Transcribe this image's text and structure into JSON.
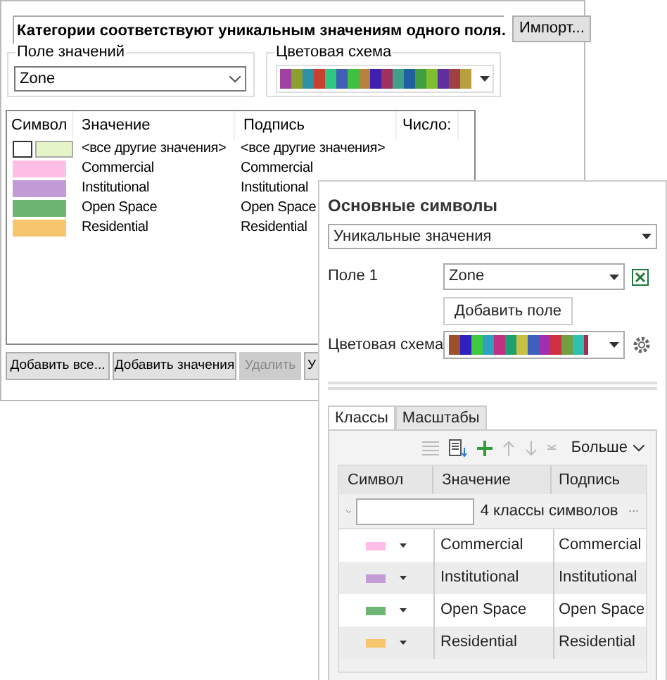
{
  "dialog": {
    "description": "Категории соответствуют уникальным значениям одного поля.",
    "import_button": "Импорт...",
    "value_field": {
      "legend": "Поле значений",
      "value": "Zone"
    },
    "color_scheme": {
      "legend": "Цветовая схема"
    },
    "table": {
      "columns": [
        "Символ",
        "Значение",
        "Подпись",
        "Число:"
      ],
      "rows": [
        {
          "kind": "other",
          "value": "<все другие значения>",
          "label": "<все другие значения>",
          "color": "#e6f5c8"
        },
        {
          "kind": "class",
          "value": "Commercial",
          "label": "Commercial",
          "color": "#ffbee6"
        },
        {
          "kind": "class",
          "value": "Institutional",
          "label": "Institutional",
          "color": "#c39bd7"
        },
        {
          "kind": "class",
          "value": "Open Space",
          "label": "Open Space",
          "color": "#6eb473"
        },
        {
          "kind": "class",
          "value": "Residential",
          "label": "Residential",
          "color": "#f7c56b"
        }
      ]
    },
    "buttons": [
      {
        "label": "Добавить все...",
        "disabled": false
      },
      {
        "label": "Добавить значения",
        "disabled": false
      },
      {
        "label": "Удалить",
        "disabled": true
      },
      {
        "label": "У",
        "disabled": false
      }
    ]
  },
  "pane": {
    "title": "Основные символы",
    "method": "Уникальные значения",
    "field_label": "Поле 1",
    "field_value": "Zone",
    "add_field_button": "Добавить поле",
    "color_scheme_label": "Цветовая схема",
    "tabs": [
      {
        "label": "Классы",
        "selected": true
      },
      {
        "label": "Масштабы",
        "selected": false
      }
    ],
    "more_button": "Больше",
    "table": {
      "columns": [
        "Символ",
        "Значение",
        "Подпись"
      ],
      "class_count": "4 классы символов",
      "rows": [
        {
          "value": "Commercial",
          "label": "Commercial",
          "color": "#ffbee6"
        },
        {
          "value": "Institutional",
          "label": "Institutional",
          "color": "#c39bd7"
        },
        {
          "value": "Open Space",
          "label": "Open Space",
          "color": "#6eb473"
        },
        {
          "value": "Residential",
          "label": "Residential",
          "color": "#f7c56b"
        }
      ]
    }
  }
}
